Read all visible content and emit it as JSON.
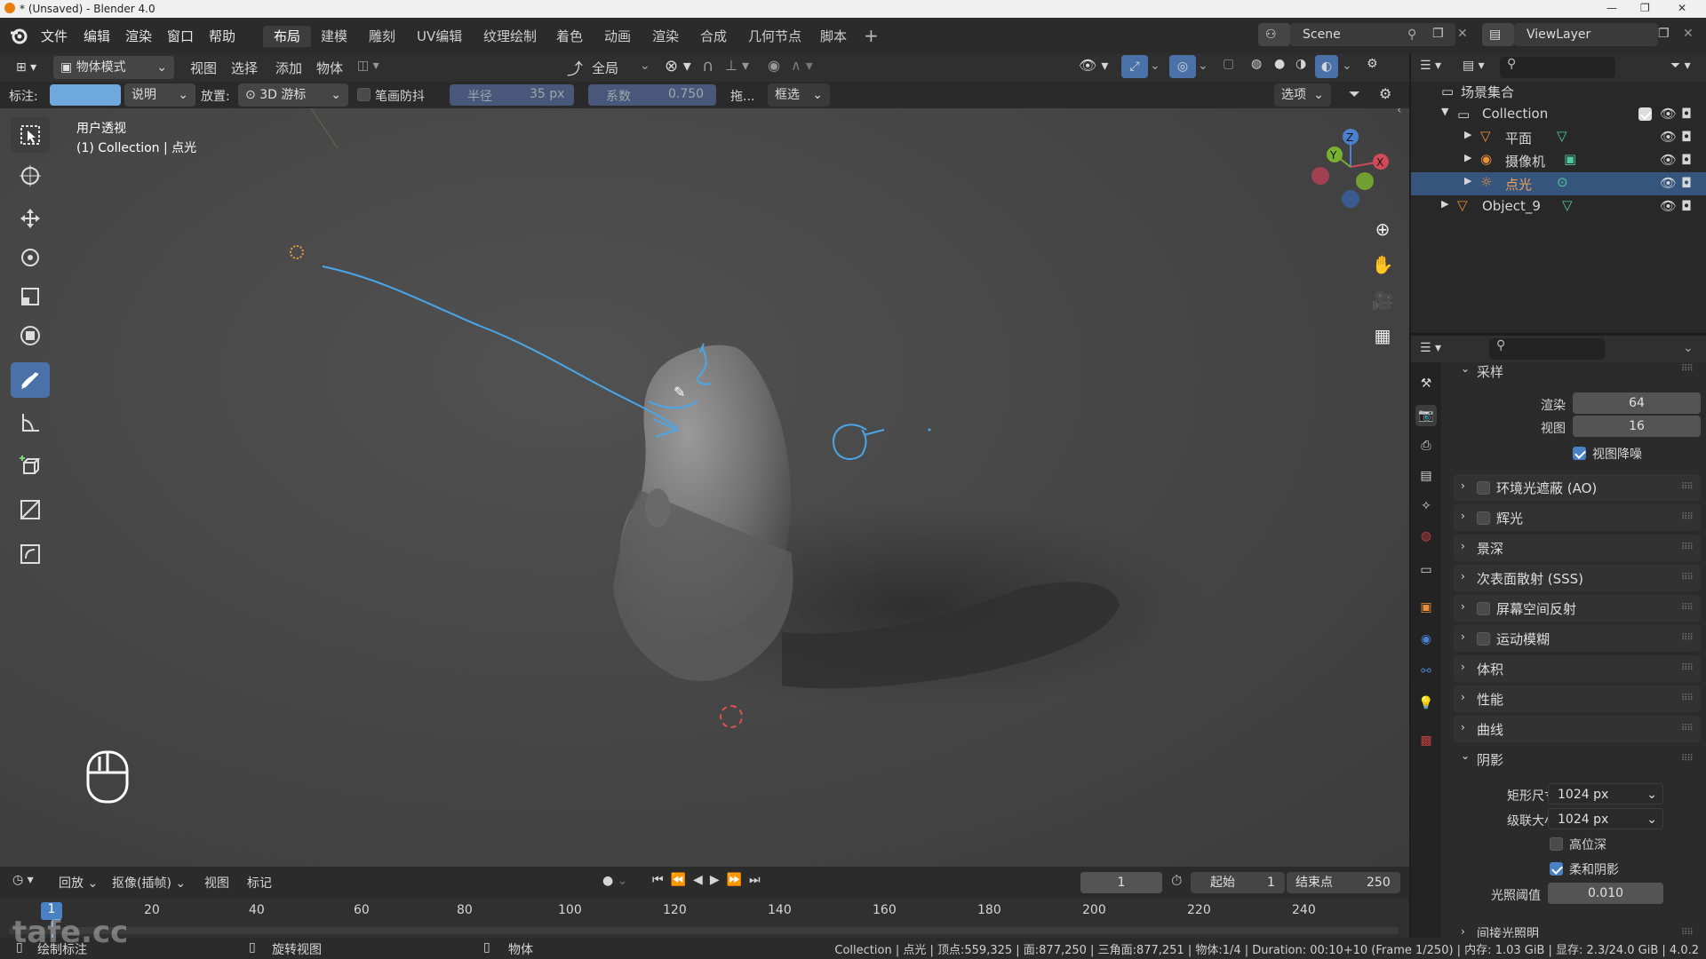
{
  "window": {
    "title": "* (Unsaved) - Blender 4.0"
  },
  "menu": {
    "items": [
      "文件",
      "编辑",
      "渲染",
      "窗口",
      "帮助"
    ]
  },
  "workspaces": [
    "布局",
    "建模",
    "雕刻",
    "UV编辑",
    "纹理绘制",
    "着色",
    "动画",
    "渲染",
    "合成",
    "几何节点",
    "脚本"
  ],
  "scene": {
    "name": "Scene",
    "viewlayer": "ViewLayer"
  },
  "viewport_header": {
    "mode": "物体模式",
    "menus": [
      "视图",
      "选择",
      "添加",
      "物体"
    ],
    "transform_orientation": "全局"
  },
  "tool_header": {
    "annotate_label": "标注:",
    "placement_type": "说明",
    "placement_label": "放置:",
    "placement_value": "3D 游标",
    "stabilize_label": "笔画防抖",
    "radius_label": "半径",
    "radius_value": "35 px",
    "factor_label": "系数",
    "factor_value": "0.750",
    "drag_label": "拖...",
    "select_mode": "框选",
    "options": "选项"
  },
  "viewport": {
    "view_name": "用户透视",
    "context": "(1) Collection | 点光"
  },
  "gizmo": {
    "x": "X",
    "y": "Y",
    "z": "Z"
  },
  "outliner": {
    "root": "场景集合",
    "rows": [
      {
        "name": "Collection",
        "type": "collection"
      },
      {
        "name": "平面",
        "type": "mesh"
      },
      {
        "name": "摄像机",
        "type": "camera"
      },
      {
        "name": "点光",
        "type": "light"
      },
      {
        "name": "Object_9",
        "type": "mesh"
      }
    ]
  },
  "properties": {
    "sampling": {
      "title": "采样",
      "render_label": "渲染",
      "render_value": "64",
      "viewport_label": "视图",
      "viewport_value": "16",
      "denoise_label": "视图降噪"
    },
    "sections": [
      "环境光遮蔽 (AO)",
      "辉光",
      "景深",
      "次表面散射 (SSS)",
      "屏幕空间反射",
      "运动模糊",
      "体积",
      "性能",
      "曲线"
    ],
    "shadows": {
      "title": "阴影",
      "cube_size_label": "矩形尺寸",
      "cube_size": "1024 px",
      "cascade_size_label": "级联大小",
      "cascade_size": "1024 px",
      "high_bitdepth": "高位深",
      "soft_shadows": "柔和阴影",
      "light_threshold_label": "光照阈值",
      "light_threshold": "0.010"
    },
    "indirect": "间接光照明"
  },
  "timeline": {
    "playback": "回放",
    "keying": "抠像(插帧)",
    "view": "视图",
    "marker": "标记",
    "current_frame": "1",
    "start_label": "起始",
    "start": "1",
    "end_label": "结束点",
    "end": "250",
    "ruler": [
      "1",
      "20",
      "40",
      "60",
      "80",
      "100",
      "120",
      "140",
      "160",
      "180",
      "200",
      "220",
      "240"
    ]
  },
  "statusbar": {
    "left": "绘制标注",
    "mid1": "旋转视图",
    "mid2": "物体",
    "stats": "Collection | 点光 | 顶点:559,325 | 面:877,250 | 三角面:877,251 | 物体:1/4 | Duration: 00:10+10 (Frame 1/250) | 内存: 1.03 GiB | 显存: 2.3/24.0 GiB | 4.0.2"
  },
  "watermark": "tafe.cc",
  "colors": {
    "accent": "#4a72a8",
    "annotation": "#4aa6e8",
    "selected_row": "#36557d"
  }
}
